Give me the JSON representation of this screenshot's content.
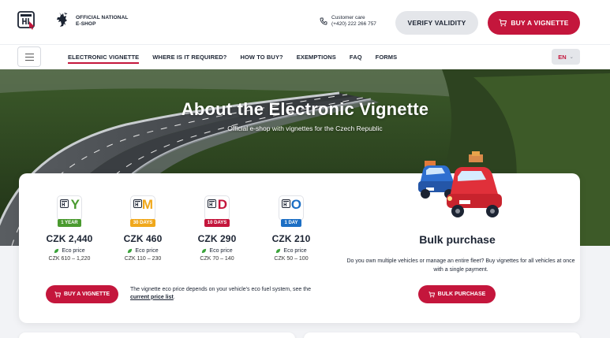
{
  "header": {
    "official_line1": "OFFICIAL NATIONAL",
    "official_line2": "E-SHOP",
    "customer_care_label": "Customer care",
    "customer_care_phone": "(+420) 222 266 757",
    "verify_label": "VERIFY VALIDITY",
    "buy_label": "BUY A VIGNETTE"
  },
  "nav": {
    "items": [
      {
        "label": "ELECTRONIC VIGNETTE",
        "active": true
      },
      {
        "label": "WHERE IS IT REQUIRED?"
      },
      {
        "label": "HOW TO BUY?"
      },
      {
        "label": "EXEMPTIONS"
      },
      {
        "label": "FAQ"
      },
      {
        "label": "FORMS"
      }
    ],
    "lang": "EN"
  },
  "hero": {
    "title": "About the Electronic Vignette",
    "subtitle": "Official e-shop with vignettes for the Czech Republic"
  },
  "products": [
    {
      "letter": "Y",
      "badge": "1 YEAR",
      "color": "#4a9a2f",
      "price": "CZK 2,440",
      "eco_label": "Eco price",
      "eco_range": "CZK 610 – 1,220"
    },
    {
      "letter": "M",
      "badge": "30 DAYS",
      "color": "#f0a81c",
      "price": "CZK 460",
      "eco_label": "Eco price",
      "eco_range": "CZK 110 – 230"
    },
    {
      "letter": "D",
      "badge": "10 DAYS",
      "color": "#c4163c",
      "price": "CZK 290",
      "eco_label": "Eco price",
      "eco_range": "CZK 70 – 140"
    },
    {
      "letter": "O",
      "badge": "1 DAY",
      "color": "#1d6fc4",
      "price": "CZK 210",
      "eco_label": "Eco price",
      "eco_range": "CZK 50 – 100"
    }
  ],
  "card": {
    "buy_label": "BUY A VIGNETTE",
    "note_text": "The vignette eco price depends on your vehicle's eco fuel system, see the ",
    "note_link": "current price list",
    "note_end": ".",
    "bulk_title": "Bulk purchase",
    "bulk_desc": "Do you own multiple vehicles or manage an entire fleet? Buy vignettes for all vehicles at once with a single payment.",
    "bulk_label": "BULK PURCHASE"
  },
  "colors": {
    "accent": "#c4163c",
    "eco_leaf": "#3aa33a"
  }
}
